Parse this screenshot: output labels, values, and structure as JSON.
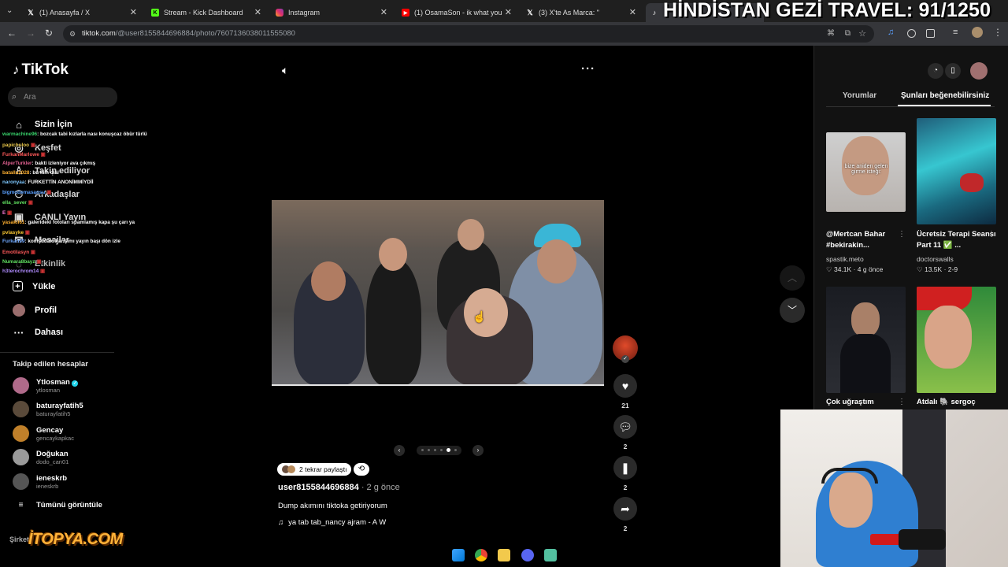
{
  "browser": {
    "tabs": [
      {
        "title": "(1) Anasayfa / X",
        "icon": "x-icon",
        "color": "#ffffff"
      },
      {
        "title": "Stream - Kick Dashboard",
        "icon": "kick-icon",
        "color": "#53fc18"
      },
      {
        "title": "Instagram",
        "icon": "instagram-icon",
        "color": "#e1306c"
      },
      {
        "title": "(1) OsamaSon - ik what you",
        "icon": "youtube-icon",
        "color": "#ff0000"
      },
      {
        "title": "(3) X'te As Marca: \"",
        "icon": "x-icon",
        "color": "#ffffff"
      },
      {
        "title": "",
        "icon": "tiktok-icon",
        "color": "#ffffff"
      }
    ],
    "url_host": "tiktok.com",
    "url_path": "/@user8155844696884/photo/7607136038011555080"
  },
  "overlay_title": "HİNDİSTAN GEZİ TRAVEL: 91/1250",
  "sidebar": {
    "logo": "TikTok",
    "search_placeholder": "Ara",
    "nav": [
      {
        "label": "Sizin İçin",
        "icon": "home-icon"
      },
      {
        "label": "Keşfet",
        "icon": "compass-icon"
      },
      {
        "label": "Takip ediliyor",
        "icon": "following-icon"
      },
      {
        "label": "Arkadaşlar",
        "icon": "friends-icon"
      },
      {
        "label": "CANLI Yayın",
        "icon": "live-icon"
      },
      {
        "label": "Mesajlar",
        "icon": "messages-icon"
      },
      {
        "label": "Etkinlik",
        "icon": "activity-icon"
      },
      {
        "label": "Yükle",
        "icon": "upload-icon"
      },
      {
        "label": "Profil",
        "icon": "profile-icon"
      },
      {
        "label": "Dahası",
        "icon": "more-icon"
      }
    ],
    "followed_title": "Takip edilen hesaplar",
    "accounts": [
      {
        "name": "Ytlosman",
        "handle": "ytlosman",
        "verified": true,
        "color": "#b06a8a"
      },
      {
        "name": "baturayfatih5",
        "handle": "baturayfatih5",
        "verified": false,
        "color": "#5a4a3a"
      },
      {
        "name": "Gencay",
        "handle": "gencaykapkac",
        "verified": false,
        "color": "#c0802a"
      },
      {
        "name": "Doğukan",
        "handle": "dodo_can01",
        "verified": false,
        "color": "#9a9a9a"
      },
      {
        "name": "ieneskrb",
        "handle": "ieneskrb",
        "verified": false,
        "color": "#555555"
      }
    ],
    "see_all": "Tümünü görüntüle",
    "bottom_partial": "Şirket"
  },
  "chat": [
    {
      "user": "warmachine96",
      "msg": ": bozcak tabi kızlarla nası konuşcaz öbür türlü",
      "color": "#38d26b"
    },
    {
      "user": "papichuloo",
      "msg": "",
      "color": "#e8c64a"
    },
    {
      "user": "FurkanMarlowe",
      "msg": "",
      "color": "#ff5a5a"
    },
    {
      "user": "AlperTurkler",
      "msg": ": bakti izleniyor ava çıkmış",
      "color": "#e06090"
    },
    {
      "user": "batalla1028",
      "msg": ": bu kim olal",
      "color": "#ffb030"
    },
    {
      "user": "naronyaa",
      "msg": ": FURKETTİN ANONİMMİYDİİ",
      "color": "#7ec8ff"
    },
    {
      "user": "bigmodemasaosu",
      "msg": "",
      "color": "#5aa0ff"
    },
    {
      "user": "ella_sever",
      "msg": "",
      "color": "#60e060"
    },
    {
      "user": "E",
      "msg": "",
      "color": "#ff7ad9"
    },
    {
      "user": "yasakli61",
      "msg": ": galerideki fotoları spamlamış kapa şu çarı ya",
      "color": "#ffb030"
    },
    {
      "user": "pvlasyke",
      "msg": "",
      "color": "#ffcc33"
    },
    {
      "user": "Furkan99",
      "msg": ": komşudaki karışımı yayın başı dön izle",
      "color": "#6fa8ff"
    },
    {
      "user": "Emotilasyn",
      "msg": "",
      "color": "#ff5a5a"
    },
    {
      "user": "Numara8bayz",
      "msg": "",
      "color": "#60e060"
    },
    {
      "user": "h3terochrom14",
      "msg": "",
      "color": "#b08cff"
    }
  ],
  "post": {
    "repost_label": "2 tekrar paylaştı",
    "username": "user8155844696884",
    "ago": " · 2 g önce",
    "caption": "Dump akımını tiktoka getiriyorum",
    "music": "ya tab tab_nancy ajram - A W",
    "slide_count": 6,
    "active_slide": 4,
    "likes": "21",
    "comments": "2",
    "saves": "2",
    "shares": "2"
  },
  "right_panel": {
    "tabs": [
      "Yorumlar",
      "Şunları beğenebilirsiniz"
    ],
    "videos": [
      {
        "title": "@Mertcan Bahar #bekirakin...",
        "user": "spastik.meto",
        "likes": "34.1K",
        "ago": "4 g önce",
        "overlay": "bize aniden gelen girme isteği:"
      },
      {
        "title": "Ücretsiz Terapi Seansı Part 11 ✅ ...",
        "user": "doctorswalls",
        "likes": "13.5K",
        "ago": "2-9",
        "overlay": ""
      },
      {
        "title": "Çok uğraştım",
        "user": "",
        "likes": "",
        "ago": "",
        "overlay": ""
      },
      {
        "title": "Atdalı 🐘 sergoç",
        "user": "",
        "likes": "",
        "ago": "",
        "overlay": ""
      }
    ]
  },
  "watermark": "İTOPYA.COM"
}
